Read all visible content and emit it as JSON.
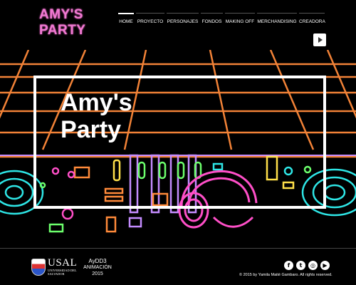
{
  "site": {
    "logo": "AMY'S PARTY"
  },
  "nav": {
    "items": [
      {
        "label": "HOME",
        "active": true
      },
      {
        "label": "PROYECTO",
        "active": false
      },
      {
        "label": "PERSONAJES",
        "active": false
      },
      {
        "label": "FONDOS",
        "active": false
      },
      {
        "label": "MAKING OFF",
        "active": false
      },
      {
        "label": "MERCHANDISING",
        "active": false
      },
      {
        "label": "CREADORA",
        "active": false
      }
    ]
  },
  "hero": {
    "title": "Amy's Party"
  },
  "footer": {
    "usal_name": "USAL",
    "usal_subtitle": "UNIVERSIDAD DEL SALVADOR",
    "course_line1": "AyDD3",
    "course_line2": "ANIMACIÓN",
    "course_line3": "2015",
    "copyright": "© 2015 by Yamila Maité Gambaro. All rights reserved.",
    "social": [
      {
        "icon": "facebook-icon",
        "glyph": "f"
      },
      {
        "icon": "twitter-icon",
        "glyph": "t"
      },
      {
        "icon": "instagram-icon",
        "glyph": "◎"
      },
      {
        "icon": "youtube-icon",
        "glyph": "▶"
      }
    ]
  },
  "colors": {
    "logo_pink": "#f07ad2",
    "grid_orange": "#ff8a3a",
    "neon_cyan": "#2ee6e6",
    "neon_green": "#6cff6c",
    "neon_pink": "#ff4fc8"
  }
}
